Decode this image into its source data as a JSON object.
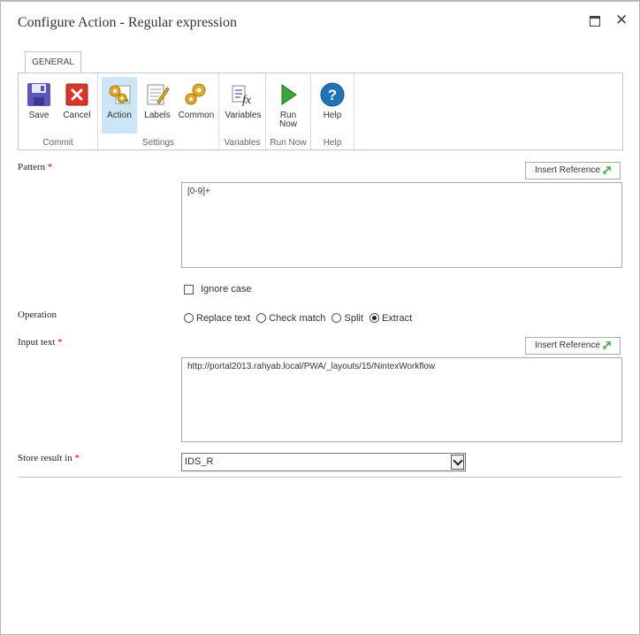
{
  "dialog": {
    "title": "Configure Action - Regular expression",
    "maximize_icon": "maximize-icon",
    "close_icon": "close-icon",
    "close_glyph": "✕"
  },
  "ribbon": {
    "tab": "GENERAL",
    "groups": {
      "commit": "Commit",
      "settings": "Settings",
      "variables": "Variables",
      "run_now": "Run Now",
      "help": "Help"
    },
    "buttons": {
      "save": "Save",
      "cancel": "Cancel",
      "action": "Action",
      "labels": "Labels",
      "common": "Common",
      "variables": "Variables",
      "run_now_line1": "Run",
      "run_now_line2": "Now",
      "help": "Help"
    }
  },
  "form": {
    "pattern_label": "Pattern",
    "required_marker": "*",
    "insert_reference": "Insert Reference",
    "pattern_value": "[0-9]+",
    "ignore_case_label": "Ignore case",
    "ignore_case_checked": false,
    "operation_label": "Operation",
    "operations": [
      {
        "label": "Replace text",
        "selected": false
      },
      {
        "label": "Check match",
        "selected": false
      },
      {
        "label": "Split",
        "selected": false
      },
      {
        "label": "Extract",
        "selected": true
      }
    ],
    "input_text_label": "Input text",
    "input_text_value": "http://portal2013.rahyab.local/PWA/_layouts/15/NintexWorkflow",
    "store_result_label": "Store result in",
    "store_result_value": "IDS_R"
  },
  "colors": {
    "accent_blue": "#1f73b7",
    "active_button_bg": "#cde6f7",
    "required": "#cc0000",
    "cancel_red": "#d9352a",
    "run_green": "#3aa43a"
  }
}
